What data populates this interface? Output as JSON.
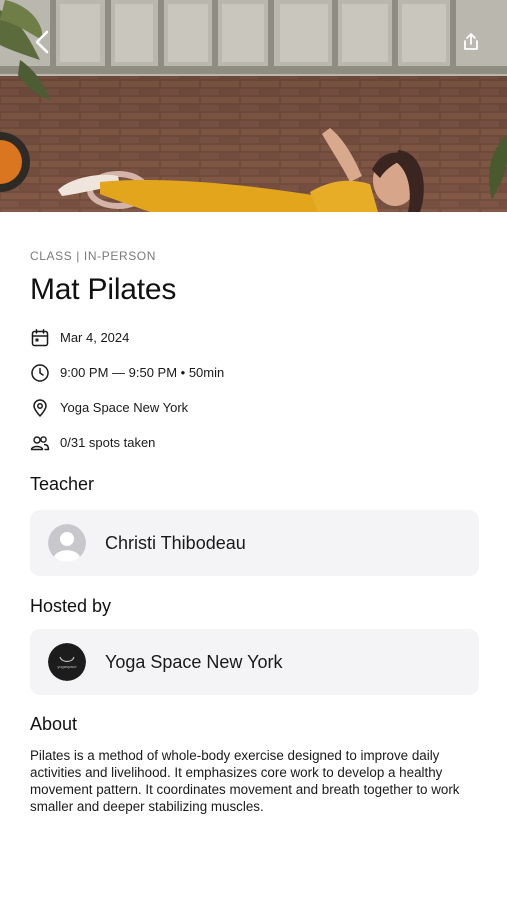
{
  "header": {
    "back_icon": "chevron-left-icon",
    "share_icon": "share-icon"
  },
  "event": {
    "eyebrow": "CLASS | IN-PERSON",
    "title": "Mat Pilates",
    "date": "Mar 4, 2024",
    "time": "9:00 PM — 9:50 PM • 50min",
    "location": "Yoga Space New York",
    "spots": "0/31 spots taken"
  },
  "teacher": {
    "section_title": "Teacher",
    "name": "Christi Thibodeau"
  },
  "host": {
    "section_title": "Hosted by",
    "name": "Yoga Space New York",
    "logo_text": "yogaspace"
  },
  "about": {
    "section_title": "About",
    "text": "Pilates is a method of whole-body exercise designed to improve daily activities and livelihood. It emphasizes core work to develop a healthy movement pattern. It coordinates movement and breath together to work smaller and deeper stabilizing muscles."
  },
  "colors": {
    "card_bg": "#f4f4f6",
    "muted_text": "#7a7a7a",
    "leggings": "#e2a51c"
  }
}
